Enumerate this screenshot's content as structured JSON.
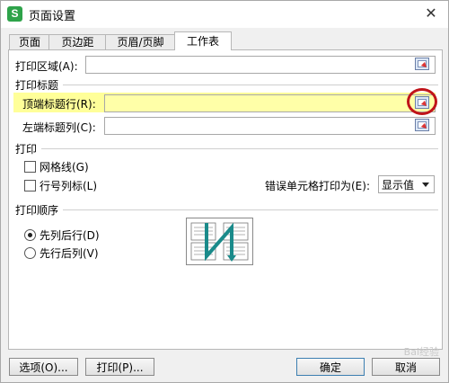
{
  "window": {
    "title": "页面设置",
    "app_icon_letter": "S"
  },
  "tabs": [
    {
      "label": "页面",
      "active": false
    },
    {
      "label": "页边距",
      "active": false
    },
    {
      "label": "页眉/页脚",
      "active": false
    },
    {
      "label": "工作表",
      "active": true
    }
  ],
  "print_area": {
    "label": "打印区域(A):",
    "value": ""
  },
  "print_titles": {
    "section": "打印标题",
    "top_rows_label": "顶端标题行(R):",
    "top_rows_value": "",
    "left_cols_label": "左端标题列(C):",
    "left_cols_value": ""
  },
  "print_options": {
    "section": "打印",
    "gridlines_label": "网格线(G)",
    "gridlines_checked": false,
    "row_col_headers_label": "行号列标(L)",
    "row_col_headers_checked": false,
    "cell_errors_label": "错误单元格打印为(E):",
    "cell_errors_value": "显示值"
  },
  "page_order": {
    "section": "打印顺序",
    "down_then_over_label": "先列后行(D)",
    "over_then_down_label": "先行后列(V)",
    "selected": "down_then_over"
  },
  "buttons": {
    "options": "选项(O)...",
    "print": "打印(P)...",
    "ok": "确定",
    "cancel": "取消"
  },
  "colors": {
    "highlight": "#ffff99",
    "annotation_circle": "#c0141a",
    "app_icon": "#2ea34a",
    "order_arrow": "#1a8a8a"
  },
  "watermark": "Bai经验"
}
